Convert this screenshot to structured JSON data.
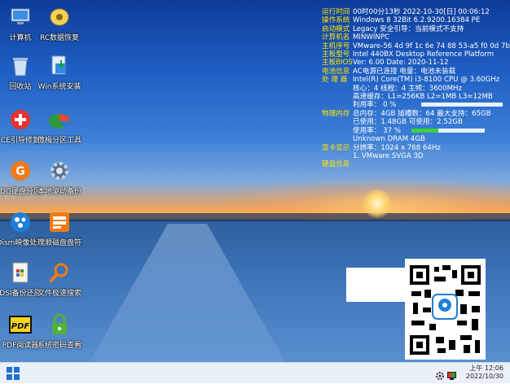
{
  "desktop_icons": [
    {
      "label": "计算机",
      "icon": "computer-icon"
    },
    {
      "label": "RC数据恢复",
      "icon": "rc-recovery-icon"
    },
    {
      "label": "回收站",
      "icon": "recycle-bin-icon"
    },
    {
      "label": "Win系统安装",
      "icon": "win-install-icon"
    },
    {
      "label": "CE引导修复",
      "icon": "boot-repair-icon"
    },
    {
      "label": "傲梅分区工具",
      "icon": "aomei-partition-icon"
    },
    {
      "label": "DG硬盘分区",
      "icon": "diskgenius-icon"
    },
    {
      "label": "本地驱动备份",
      "icon": "driver-backup-icon"
    },
    {
      "label": "Dism映像处理",
      "icon": "dism-icon"
    },
    {
      "label": "理顺磁盘盘符",
      "icon": "drive-letter-icon"
    },
    {
      "label": "DSI备份还原",
      "icon": "dsi-backup-icon"
    },
    {
      "label": "文件极速搜索",
      "icon": "file-search-icon"
    },
    {
      "label": "PDF阅读器",
      "icon": "pdf-reader-icon"
    },
    {
      "label": "系统密码查看",
      "icon": "password-lock-icon"
    }
  ],
  "sysinfo": {
    "r1_k": "运行时间",
    "r1_v": "00时00分13秒 2022-10-30[日] 00:06:12",
    "r2_k": "操作系统",
    "r2_v": "Windows 8 32Bit 6.2.9200.16384 PE",
    "r3_k": "启动模式",
    "r3_v": "Legacy       安全引导：当前模式不支持",
    "r4_k": "计算机名",
    "r4_v": "MINWINPC",
    "r5_k": "主机序号",
    "r5_v": "VMware-56 4d 9f 1c 6e 74 88 53-a5 f0 0d 7b 92",
    "r6_k": "主板型号",
    "r6_v": "Intel 440BX Desktop Reference Platform",
    "r7_k": "主板BIOS",
    "r7_v": "Ver: 6.00  Date: 2020-11-12",
    "r8_k": "电池信息",
    "r8_v": "AC电源已连接  电量：电池未装载",
    "r9_k": "处 理 器",
    "r9_v": "Intel(R) Core(TM) i3-8100 CPU @ 3.60GHz",
    "r10_v": "核心：4   线程：4        主频：3600MHz",
    "r11_v": "高速缓存：L1=256KB L2=1MB L3=12MB",
    "r12_v": "利用率：  0 %",
    "r13_k": "物理内存",
    "r13_v": "总内存：4GB 插槽数：64 最大支持：65GB",
    "r14_v": "已使用：1.48GB        可使用：2.52GB",
    "r15_v": "使用率：  37 %",
    "r16_v": "Unknown DRAM 4GB",
    "r17_k": "显卡显示",
    "r17_v": "分辨率：1024 x 768 64Hz",
    "r18_v": "1. VMware SVGA 3D",
    "r19_k": "硬盘信息"
  },
  "usage": {
    "cpu_percent": 0,
    "mem_percent": 37
  },
  "taskbar": {
    "time": "上午 12:06",
    "date": "2022/10/30"
  }
}
